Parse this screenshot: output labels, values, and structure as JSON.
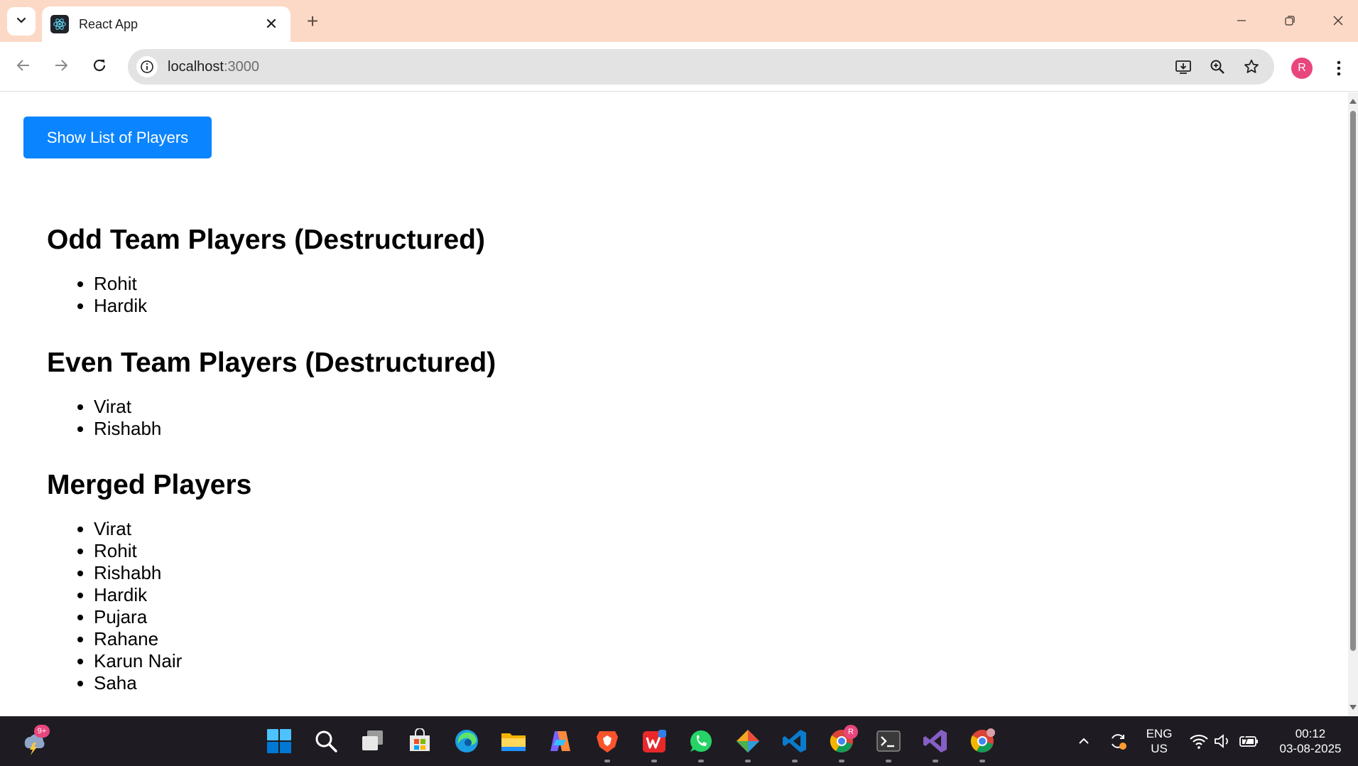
{
  "browser": {
    "tab_title": "React App",
    "tab_close": "✕",
    "new_tab": "+",
    "url_host": "localhost",
    "url_port": ":3000",
    "profile_initial": "R"
  },
  "page": {
    "button_label": "Show List of Players",
    "sections": [
      {
        "heading": "Odd Team Players (Destructured)",
        "items": [
          "Rohit",
          "Hardik"
        ]
      },
      {
        "heading": "Even Team Players (Destructured)",
        "items": [
          "Virat",
          "Rishabh"
        ]
      },
      {
        "heading": "Merged Players",
        "items": [
          "Virat",
          "Rohit",
          "Rishabh",
          "Hardik",
          "Pujara",
          "Rahane",
          "Karun Nair",
          "Saha"
        ]
      }
    ]
  },
  "taskbar": {
    "weather_badge": "9+",
    "language_line1": "ENG",
    "language_line2": "US",
    "time": "00:12",
    "date": "03-08-2025",
    "chrome_badge": "R"
  },
  "colors": {
    "title_bar": "#fcd9c6",
    "button_blue": "#0a84ff",
    "profile_pink": "#e8467c",
    "taskbar": "#1e1c22"
  }
}
